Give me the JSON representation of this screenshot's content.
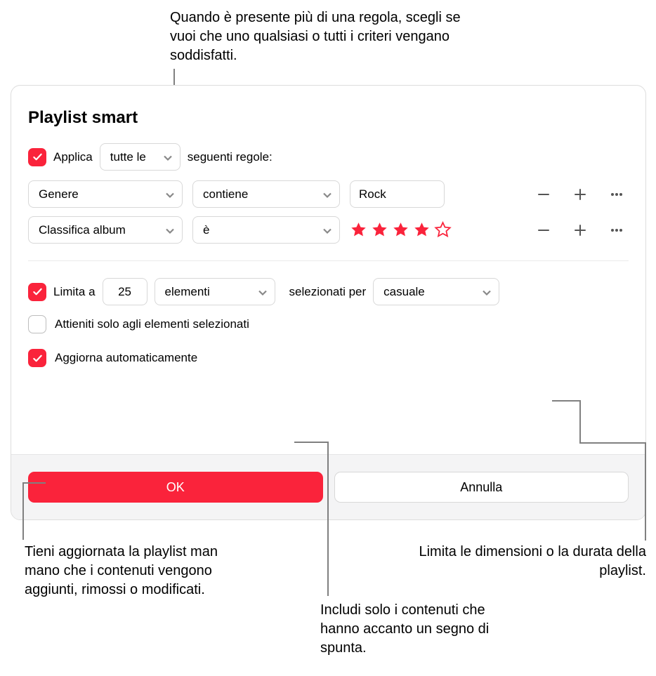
{
  "callouts": {
    "top": "Quando è presente più di una regola, scegli se vuoi che uno qualsiasi o tutti i criteri vengano soddisfatti.",
    "bottom_left": "Tieni aggiornata la playlist man mano che i contenuti vengono aggiunti, rimossi o modificati.",
    "bottom_mid": "Includi solo i contenuti che hanno accanto un segno di spunta.",
    "bottom_right": "Limita le dimensioni o la durata della playlist."
  },
  "dialog": {
    "title": "Playlist smart",
    "apply_label": "Applica",
    "match_mode": "tutte le",
    "apply_suffix": "seguenti regole:",
    "rules": [
      {
        "attribute": "Genere",
        "operator": "contiene",
        "value": "Rock",
        "stars": null
      },
      {
        "attribute": "Classifica album",
        "operator": "è",
        "value": null,
        "stars": 4
      }
    ],
    "limit": {
      "label": "Limita a",
      "value": "25",
      "unit": "elementi",
      "mid": "selezionati per",
      "by": "casuale"
    },
    "only_checked_label": "Attieniti solo agli elementi selezionati",
    "live_update_label": "Aggiorna automaticamente",
    "buttons": {
      "ok": "OK",
      "cancel": "Annulla"
    }
  }
}
